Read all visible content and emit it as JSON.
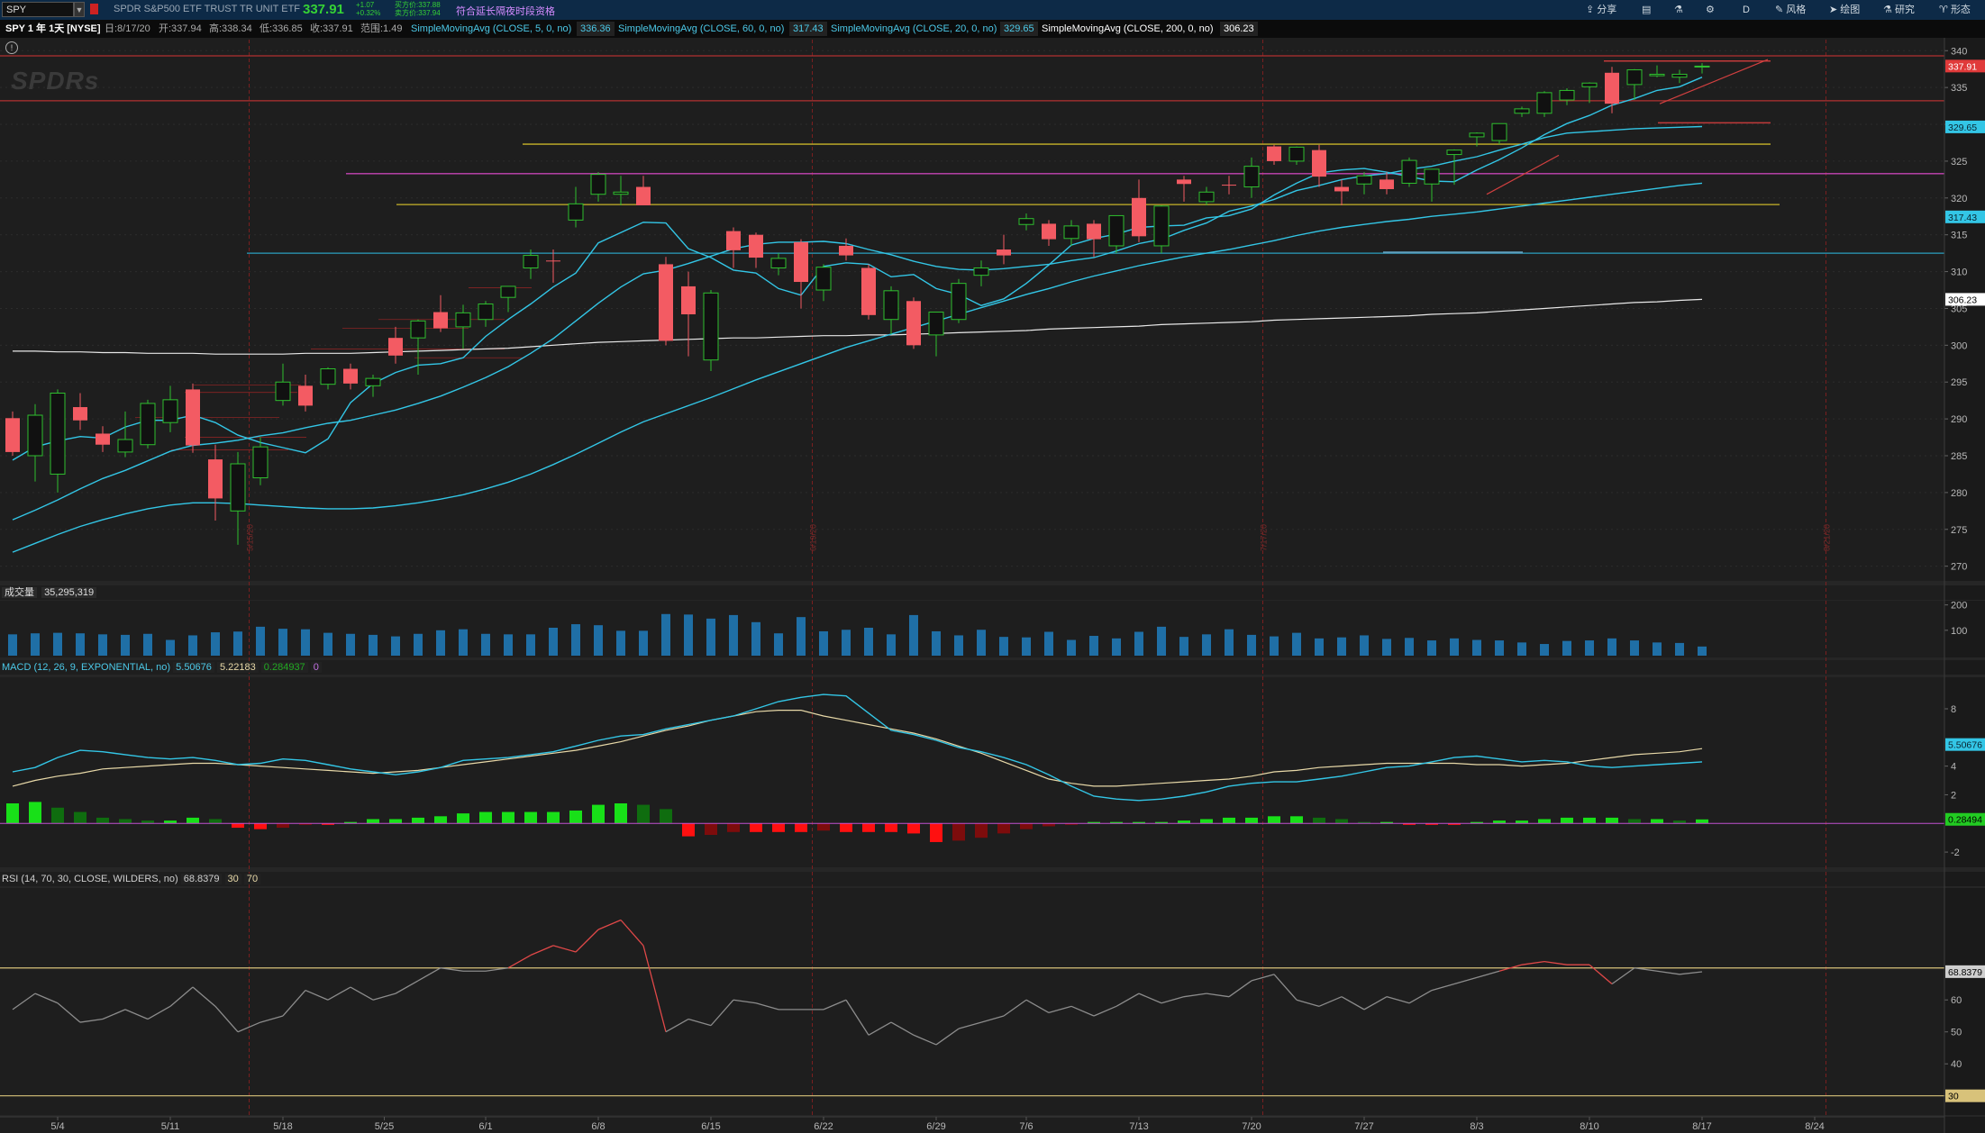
{
  "topbar": {
    "symbol": "SPY",
    "description": "SPDR S&P500 ETF TRUST TR UNIT ETF",
    "last": "337.91",
    "change": "+1.07",
    "change_pct": "+0.32%",
    "bid": "买方价:337.88",
    "ask": "卖方价:337.94",
    "extended": "符合延长隔夜时段资格",
    "tools": [
      {
        "label": "分享",
        "icon": "share-icon"
      },
      {
        "label": "",
        "icon": "layout-icon"
      },
      {
        "label": "",
        "icon": "flask-icon"
      },
      {
        "label": "",
        "icon": "gear-icon"
      },
      {
        "label": "D",
        "icon": ""
      },
      {
        "label": "风格",
        "icon": "style-icon"
      },
      {
        "label": "绘图",
        "icon": "cursor-icon"
      },
      {
        "label": "研究",
        "icon": "flask-icon"
      },
      {
        "label": "形态",
        "icon": "pattern-icon"
      }
    ]
  },
  "infobar": {
    "title": "SPY 1 年 1天 [NYSE]",
    "date": "日:8/17/20",
    "open": "开:337.94",
    "high": "高:338.34",
    "low": "低:336.85",
    "close": "收:337.91",
    "range": "范围:1.49",
    "studies": [
      {
        "label": "SimpleMovingAvg (CLOSE, 5, 0, no)",
        "value": "336.36",
        "color": "#4cc9e8"
      },
      {
        "label": "SimpleMovingAvg (CLOSE, 60, 0, no)",
        "value": "317.43",
        "color": "#4cc9e8"
      },
      {
        "label": "SimpleMovingAvg (CLOSE, 20, 0, no)",
        "value": "329.65",
        "color": "#4cc9e8"
      },
      {
        "label": "SimpleMovingAvg (CLOSE, 200, 0, no)",
        "value": "306.23",
        "color": "#ffffff"
      }
    ]
  },
  "watermark": "SPDRs",
  "volume_label": "成交量",
  "volume_value": "35,295,319",
  "macd_label": "MACD (12, 26, 9, EXPONENTIAL, no)",
  "macd_values": [
    "5.50676",
    "5.22183",
    "0.284937",
    "0"
  ],
  "rsi_label": "RSI (14, 70, 30, CLOSE, WILDERS, no)",
  "rsi_values": [
    "68.8379",
    "30",
    "70"
  ],
  "price_tags": [
    {
      "label": "337.91",
      "value": 337.91,
      "bg": "#e03a3a",
      "fg": "#ffffff"
    },
    {
      "label": "329.65",
      "value": 329.65,
      "bg": "#33c6e6",
      "fg": "#0b2430"
    },
    {
      "label": "317.43",
      "value": 317.43,
      "bg": "#33c6e6",
      "fg": "#0b2430"
    },
    {
      "label": "306.23",
      "value": 306.23,
      "bg": "#ffffff",
      "fg": "#000000"
    }
  ],
  "macd_tags": [
    {
      "label": "5.50676",
      "value": 5.50676,
      "bg": "#33c6e6",
      "fg": "#0b2430"
    },
    {
      "label": "0.28494",
      "value": 0.28494,
      "bg": "#22cc22",
      "fg": "#000000"
    }
  ],
  "rsi_tags": [
    {
      "label": "68.8379",
      "value": 68.8379,
      "bg": "#cfcfcf",
      "fg": "#000000"
    },
    {
      "label": "30",
      "value": 30,
      "bg": "#d8c27a",
      "fg": "#000000"
    }
  ],
  "vertical_marks": [
    {
      "date": "5/15/20",
      "idx": 10.5
    },
    {
      "date": "6/19/20",
      "idx": 35.5
    },
    {
      "date": "7/17/20",
      "idx": 55.5
    },
    {
      "date": "8/21/20",
      "idx": 80.5
    }
  ],
  "chart_data": {
    "type": "candlestick",
    "dates": [
      "4/30",
      "5/1",
      "5/4",
      "5/5",
      "5/6",
      "5/7",
      "5/8",
      "5/11",
      "5/12",
      "5/13",
      "5/14",
      "5/15",
      "5/18",
      "5/19",
      "5/20",
      "5/21",
      "5/22",
      "5/26",
      "5/27",
      "5/28",
      "5/29",
      "6/1",
      "6/2",
      "6/3",
      "6/4",
      "6/5",
      "6/8",
      "6/9",
      "6/10",
      "6/11",
      "6/12",
      "6/15",
      "6/16",
      "6/17",
      "6/18",
      "6/19",
      "6/22",
      "6/23",
      "6/24",
      "6/25",
      "6/26",
      "6/29",
      "6/30",
      "7/1",
      "7/2",
      "7/6",
      "7/7",
      "7/8",
      "7/9",
      "7/10",
      "7/13",
      "7/14",
      "7/15",
      "7/16",
      "7/17",
      "7/20",
      "7/21",
      "7/22",
      "7/23",
      "7/24",
      "7/27",
      "7/28",
      "7/29",
      "7/30",
      "7/31",
      "8/3",
      "8/4",
      "8/5",
      "8/6",
      "8/7",
      "8/10",
      "8/11",
      "8/12",
      "8/13",
      "8/14",
      "8/17"
    ],
    "x_tick_labels": [
      {
        "label": "5/4",
        "idx": 2
      },
      {
        "label": "5/11",
        "idx": 7
      },
      {
        "label": "5/18",
        "idx": 12
      },
      {
        "label": "5/25",
        "idx": 16.5
      },
      {
        "label": "6/1",
        "idx": 21
      },
      {
        "label": "6/8",
        "idx": 26
      },
      {
        "label": "6/15",
        "idx": 31
      },
      {
        "label": "6/22",
        "idx": 36
      },
      {
        "label": "6/29",
        "idx": 41
      },
      {
        "label": "7/6",
        "idx": 45
      },
      {
        "label": "7/13",
        "idx": 50
      },
      {
        "label": "7/20",
        "idx": 55
      },
      {
        "label": "7/27",
        "idx": 60
      },
      {
        "label": "8/3",
        "idx": 65
      },
      {
        "label": "8/10",
        "idx": 70
      },
      {
        "label": "8/17",
        "idx": 75
      },
      {
        "label": "8/24",
        "idx": 80
      }
    ],
    "ohlc": [
      [
        290.1,
        291.0,
        285.0,
        285.5
      ],
      [
        285.0,
        292.0,
        281.5,
        290.5
      ],
      [
        282.5,
        294.0,
        280.0,
        293.5
      ],
      [
        291.6,
        293.5,
        288.5,
        289.8
      ],
      [
        288.0,
        289.0,
        285.5,
        286.5
      ],
      [
        285.5,
        291.0,
        284.8,
        287.2
      ],
      [
        286.5,
        292.6,
        286.0,
        292.1
      ],
      [
        289.5,
        294.5,
        288.2,
        292.6
      ],
      [
        294.0,
        294.8,
        285.4,
        286.4
      ],
      [
        284.5,
        286.5,
        276.2,
        279.2
      ],
      [
        277.5,
        285.5,
        272.9,
        283.9
      ],
      [
        282.0,
        287.5,
        281.0,
        286.2
      ],
      [
        292.5,
        297.5,
        291.8,
        295.0
      ],
      [
        294.5,
        296.0,
        291.0,
        291.8
      ],
      [
        294.7,
        297.0,
        294.0,
        296.8
      ],
      [
        296.8,
        297.5,
        294.0,
        294.8
      ],
      [
        294.5,
        296.0,
        293.0,
        295.5
      ],
      [
        301.0,
        302.5,
        297.5,
        298.6
      ],
      [
        301.0,
        303.5,
        296.0,
        303.3
      ],
      [
        304.5,
        306.8,
        301.8,
        302.3
      ],
      [
        302.5,
        305.5,
        299.5,
        304.4
      ],
      [
        303.5,
        306.0,
        302.5,
        305.6
      ],
      [
        306.5,
        308.0,
        304.5,
        308.0
      ],
      [
        310.5,
        313.0,
        309.0,
        312.2
      ],
      [
        311.5,
        313.0,
        308.5,
        311.4
      ],
      [
        317.0,
        321.5,
        316.0,
        319.2
      ],
      [
        320.5,
        323.5,
        319.5,
        323.2
      ],
      [
        320.5,
        323.0,
        319.0,
        320.8
      ],
      [
        321.5,
        323.0,
        319.0,
        319.0
      ],
      [
        311.0,
        312.0,
        300.0,
        300.6
      ],
      [
        308.0,
        310.0,
        298.5,
        304.2
      ],
      [
        298.0,
        307.5,
        296.5,
        307.1
      ],
      [
        315.5,
        316.0,
        310.5,
        312.9
      ],
      [
        315.0,
        315.3,
        310.5,
        311.9
      ],
      [
        310.5,
        312.5,
        309.5,
        311.8
      ],
      [
        314.0,
        314.4,
        305.0,
        308.6
      ],
      [
        307.5,
        311.0,
        306.0,
        310.6
      ],
      [
        313.5,
        314.5,
        311.5,
        312.2
      ],
      [
        310.5,
        311.0,
        303.5,
        304.1
      ],
      [
        303.5,
        308.0,
        301.5,
        307.4
      ],
      [
        306.0,
        306.5,
        299.5,
        300.0
      ],
      [
        301.4,
        304.5,
        298.5,
        304.5
      ],
      [
        303.5,
        309.0,
        303.0,
        308.4
      ],
      [
        309.5,
        311.5,
        308.0,
        310.5
      ],
      [
        313.0,
        315.0,
        311.0,
        312.2
      ],
      [
        316.4,
        317.9,
        315.6,
        317.2
      ],
      [
        316.5,
        317.0,
        313.5,
        314.4
      ],
      [
        314.5,
        317.0,
        313.5,
        316.2
      ],
      [
        316.5,
        317.0,
        312.0,
        314.4
      ],
      [
        313.5,
        317.5,
        312.5,
        317.6
      ],
      [
        320.0,
        322.5,
        314.0,
        314.8
      ],
      [
        313.5,
        319.0,
        312.5,
        318.9
      ],
      [
        322.5,
        323.0,
        319.5,
        321.9
      ],
      [
        319.5,
        321.5,
        319.0,
        320.8
      ],
      [
        321.8,
        323.0,
        320.5,
        321.7
      ],
      [
        321.5,
        325.5,
        320.0,
        324.3
      ],
      [
        327.0,
        327.2,
        324.5,
        325.0
      ],
      [
        325.0,
        327.0,
        324.5,
        326.9
      ],
      [
        326.5,
        327.2,
        321.5,
        322.9
      ],
      [
        321.5,
        322.5,
        319.0,
        320.9
      ],
      [
        321.9,
        323.5,
        320.5,
        323.0
      ],
      [
        322.5,
        323.5,
        320.5,
        321.2
      ],
      [
        322.0,
        325.5,
        321.5,
        325.1
      ],
      [
        321.9,
        323.9,
        319.5,
        323.9
      ],
      [
        325.9,
        326.6,
        321.8,
        326.5
      ],
      [
        328.3,
        328.9,
        327.0,
        328.8
      ],
      [
        327.8,
        330.1,
        327.3,
        330.1
      ],
      [
        331.5,
        332.4,
        331.0,
        332.1
      ],
      [
        331.5,
        334.5,
        331.0,
        334.3
      ],
      [
        333.3,
        334.9,
        332.6,
        334.6
      ],
      [
        335.1,
        335.7,
        332.9,
        335.6
      ],
      [
        337.0,
        337.8,
        331.5,
        332.8
      ],
      [
        335.4,
        337.5,
        333.3,
        337.4
      ],
      [
        336.6,
        338.0,
        336.4,
        336.8
      ],
      [
        336.4,
        337.4,
        335.6,
        336.8
      ],
      [
        337.9,
        338.3,
        336.9,
        337.9
      ]
    ],
    "volume_m": [
      84,
      88,
      90,
      88,
      84,
      82,
      86,
      62,
      80,
      92,
      95,
      114,
      106,
      104,
      90,
      86,
      82,
      76,
      86,
      100,
      104,
      86,
      84,
      84,
      110,
      124,
      120,
      98,
      98,
      164,
      162,
      146,
      160,
      132,
      88,
      152,
      96,
      102,
      110,
      84,
      160,
      96,
      80,
      102,
      74,
      72,
      94,
      62,
      78,
      68,
      94,
      114,
      74,
      84,
      104,
      82,
      76,
      90,
      68,
      72,
      80,
      66,
      70,
      60,
      68,
      62,
      60,
      52,
      46,
      58,
      60,
      68,
      60,
      52,
      50,
      36
    ],
    "sma5": [
      284.4,
      286.2,
      287.0,
      287.6,
      287.4,
      288.9,
      289.8,
      289.8,
      290.5,
      289.5,
      287.8,
      286.8,
      286.1,
      285.4,
      287.3,
      292.2,
      294.8,
      296.3,
      297.3,
      297.5,
      298.3,
      301.2,
      303.5,
      305.6,
      307.9,
      309.8,
      313.9,
      315.3,
      316.7,
      316.6,
      313.1,
      311.9,
      310.2,
      309.8,
      307.7,
      306.8,
      310.7,
      311.2,
      311.0,
      309.3,
      309.6,
      307.7,
      306.9,
      305.4,
      306.3,
      308.4,
      310.9,
      313.6,
      314.5,
      315.1,
      316.0,
      316.2,
      316.3,
      317.3,
      317.6,
      318.5,
      320.4,
      322.0,
      323.4,
      323.8,
      324.0,
      323.5,
      322.9,
      322.3,
      322.2,
      323.8,
      325.2,
      326.8,
      328.6,
      330.1,
      331.2,
      332.6,
      333.5,
      334.6,
      335.1,
      336.4
    ],
    "sma20": [
      276.3,
      277.6,
      279.0,
      280.5,
      281.9,
      283.0,
      284.3,
      285.6,
      286.4,
      286.7,
      287.1,
      287.7,
      288.1,
      288.8,
      289.4,
      289.8,
      290.5,
      291.2,
      292.1,
      293.1,
      294.3,
      295.6,
      297.1,
      298.9,
      300.9,
      303.3,
      305.7,
      307.9,
      309.7,
      310.2,
      311.1,
      312.1,
      313.1,
      313.7,
      314.0,
      314.0,
      314.1,
      313.8,
      313.0,
      312.3,
      311.4,
      310.7,
      310.3,
      310.2,
      310.4,
      310.7,
      311.0,
      311.5,
      311.9,
      312.8,
      313.8,
      314.4,
      315.6,
      316.6,
      318.2,
      318.9,
      319.8,
      321.0,
      321.7,
      322.5,
      323.0,
      323.3,
      323.9,
      324.3,
      325.0,
      325.6,
      326.5,
      327.3,
      328.2,
      328.8,
      329.0,
      329.2,
      329.4,
      329.5,
      329.6,
      329.7
    ],
    "sma60": [
      271.9,
      273.1,
      274.3,
      275.4,
      276.3,
      277.1,
      277.8,
      278.3,
      278.6,
      278.6,
      278.5,
      278.3,
      278.1,
      277.9,
      277.8,
      277.8,
      277.9,
      278.2,
      278.6,
      279.1,
      279.7,
      280.5,
      281.4,
      282.5,
      283.8,
      285.2,
      286.7,
      288.2,
      289.6,
      290.7,
      291.8,
      292.9,
      294.1,
      295.3,
      296.4,
      297.5,
      298.6,
      299.7,
      300.6,
      301.5,
      302.4,
      303.3,
      304.2,
      305.1,
      306.0,
      306.9,
      307.7,
      308.6,
      309.4,
      310.1,
      310.8,
      311.4,
      312.0,
      312.5,
      313.0,
      313.6,
      314.2,
      314.9,
      315.5,
      316.0,
      316.4,
      316.8,
      317.1,
      317.5,
      317.8,
      318.1,
      318.5,
      318.9,
      319.3,
      319.7,
      320.1,
      320.5,
      320.9,
      321.3,
      321.7,
      322.0
    ],
    "sma200": [
      299.2,
      299.2,
      299.1,
      299.1,
      299.0,
      299.0,
      298.9,
      298.9,
      298.9,
      298.8,
      298.8,
      298.8,
      298.8,
      298.9,
      298.9,
      298.9,
      299.0,
      299.1,
      299.2,
      299.3,
      299.4,
      299.5,
      299.6,
      299.8,
      300.0,
      300.2,
      300.4,
      300.5,
      300.6,
      300.7,
      300.8,
      300.9,
      301.0,
      301.0,
      301.1,
      301.2,
      301.3,
      301.3,
      301.4,
      301.4,
      301.5,
      301.6,
      301.7,
      301.8,
      301.9,
      302.0,
      302.2,
      302.3,
      302.4,
      302.5,
      302.6,
      302.8,
      302.9,
      303.0,
      303.1,
      303.2,
      303.4,
      303.5,
      303.6,
      303.7,
      303.8,
      303.9,
      304.0,
      304.2,
      304.3,
      304.4,
      304.6,
      304.8,
      305.0,
      305.2,
      305.4,
      305.6,
      305.8,
      305.9,
      306.1,
      306.23
    ],
    "macd": [
      3.6,
      3.9,
      4.6,
      5.1,
      5.0,
      4.8,
      4.6,
      4.5,
      4.6,
      4.4,
      4.1,
      4.2,
      4.5,
      4.4,
      4.1,
      3.8,
      3.6,
      3.4,
      3.6,
      3.9,
      4.4,
      4.5,
      4.6,
      4.8,
      5.0,
      5.4,
      5.8,
      6.1,
      6.2,
      6.6,
      6.9,
      7.2,
      7.5,
      8.0,
      8.5,
      8.8,
      9.0,
      8.9,
      7.7,
      6.5,
      6.2,
      5.8,
      5.3,
      5.0,
      4.6,
      4.1,
      3.4,
      2.6,
      1.9,
      1.7,
      1.6,
      1.7,
      1.9,
      2.2,
      2.6,
      2.8,
      2.9,
      2.9,
      3.1,
      3.3,
      3.6,
      3.9,
      4.0,
      4.3,
      4.6,
      4.7,
      4.5,
      4.3,
      4.4,
      4.3,
      4.0,
      3.9,
      4.0,
      4.1,
      4.2,
      4.3
    ],
    "macd_signal": [
      2.6,
      3.0,
      3.3,
      3.5,
      3.8,
      3.9,
      4.0,
      4.1,
      4.2,
      4.2,
      4.1,
      4.0,
      3.9,
      3.8,
      3.7,
      3.6,
      3.5,
      3.6,
      3.7,
      3.9,
      4.1,
      4.3,
      4.5,
      4.7,
      4.9,
      5.1,
      5.4,
      5.7,
      6.1,
      6.5,
      6.8,
      7.2,
      7.5,
      7.8,
      7.9,
      7.9,
      7.5,
      7.2,
      6.9,
      6.6,
      6.3,
      5.9,
      5.4,
      4.9,
      4.3,
      3.7,
      3.1,
      2.8,
      2.6,
      2.6,
      2.7,
      2.8,
      2.9,
      3.0,
      3.1,
      3.3,
      3.6,
      3.7,
      3.9,
      4.0,
      4.1,
      4.2,
      4.2,
      4.2,
      4.2,
      4.1,
      4.1,
      4.0,
      4.1,
      4.2,
      4.4,
      4.6,
      4.8,
      4.9,
      5.0,
      5.22
    ],
    "macd_diff": [
      1.4,
      1.5,
      1.1,
      0.8,
      0.4,
      0.3,
      0.2,
      0.2,
      0.4,
      0.3,
      -0.3,
      -0.4,
      -0.3,
      -0.1,
      -0.1,
      0.1,
      0.3,
      0.3,
      0.4,
      0.5,
      0.7,
      0.8,
      0.8,
      0.8,
      0.8,
      0.9,
      1.3,
      1.4,
      1.3,
      1.0,
      -0.9,
      -0.8,
      -0.6,
      -0.6,
      -0.6,
      -0.6,
      -0.5,
      -0.6,
      -0.6,
      -0.6,
      -0.7,
      -1.3,
      -1.2,
      -1.0,
      -0.7,
      -0.4,
      -0.2,
      -0.1,
      0.1,
      0.1,
      0.1,
      0.1,
      0.2,
      0.3,
      0.4,
      0.4,
      0.5,
      0.5,
      0.4,
      0.3,
      0.1,
      0.1,
      -0.1,
      -0.1,
      -0.1,
      0.1,
      0.2,
      0.2,
      0.3,
      0.4,
      0.4,
      0.4,
      0.3,
      0.3,
      0.2,
      0.28
    ],
    "rsi": [
      57,
      62,
      59,
      53,
      54,
      57,
      54,
      58,
      64,
      58,
      50,
      53,
      55,
      63,
      60,
      64,
      60,
      62,
      66,
      70,
      69,
      69,
      70,
      74,
      77,
      75,
      82,
      85,
      77,
      50,
      54,
      52,
      60,
      59,
      57,
      57,
      57,
      60,
      49,
      53,
      49,
      46,
      51,
      53,
      55,
      60,
      56,
      58,
      55,
      58,
      62,
      59,
      61,
      62,
      61,
      66,
      68,
      60,
      58,
      61,
      57,
      61,
      59,
      63,
      65,
      67,
      69,
      71,
      72,
      71,
      71,
      65,
      70,
      69,
      68,
      68.8
    ]
  }
}
